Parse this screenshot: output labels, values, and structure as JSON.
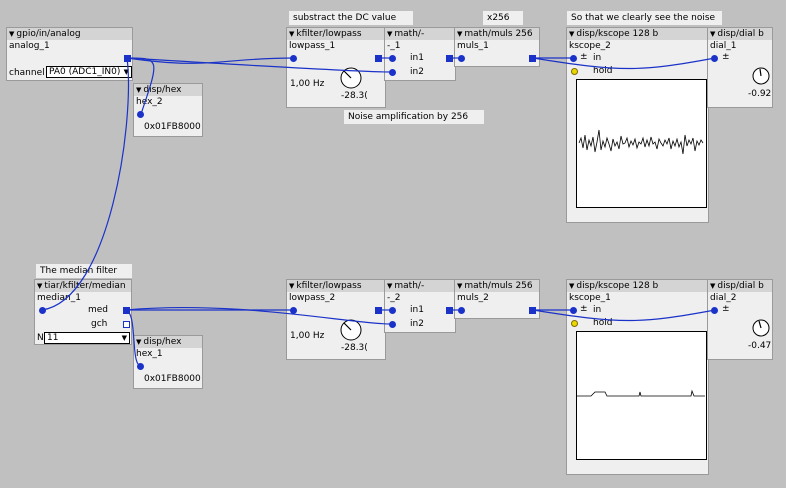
{
  "comments": {
    "dc": "substract the DC value",
    "x256": "x256",
    "noise": "So that we clearly see the noise",
    "amp": "Noise amplification by 256",
    "median": "The median filter"
  },
  "analog": {
    "type": "gpio/in/analog",
    "name": "analog_1",
    "channel_label": "channel",
    "channel_value": "PA0 (ADC1_IN0)"
  },
  "hex2": {
    "type": "disp/hex",
    "name": "hex_2",
    "value": "0x01FB8000"
  },
  "lowpass1": {
    "type": "kfilter/lowpass",
    "name": "lowpass_1",
    "freq": "1,00 Hz",
    "knob_value": "-28.3("
  },
  "minus1": {
    "type": "math/-",
    "name": "-_1",
    "in1": "in1",
    "in2": "in2"
  },
  "muls1": {
    "type": "math/muls 256",
    "name": "muls_1"
  },
  "kscope2": {
    "type": "disp/kscope 128 b",
    "name": "kscope_2",
    "pm": "±",
    "in": "in",
    "hold": "hold"
  },
  "dial1": {
    "type": "disp/dial b",
    "name": "dial_1",
    "pm": "±",
    "value": "-0.92"
  },
  "median": {
    "type": "tiar/kfilter/median",
    "name": "median_1",
    "med": "med",
    "gch": "gch",
    "n_label": "N",
    "n_value": "11"
  },
  "hex1": {
    "type": "disp/hex",
    "name": "hex_1",
    "value": "0x01FB8000"
  },
  "lowpass2": {
    "type": "kfilter/lowpass",
    "name": "lowpass_2",
    "freq": "1,00 Hz",
    "knob_value": "-28.3("
  },
  "minus2": {
    "type": "math/-",
    "name": "-_2",
    "in1": "in1",
    "in2": "in2"
  },
  "muls2": {
    "type": "math/muls 256",
    "name": "muls_2"
  },
  "kscope1": {
    "type": "disp/kscope 128 b",
    "name": "kscope_1",
    "pm": "±",
    "in": "in",
    "hold": "hold"
  },
  "dial2": {
    "type": "disp/dial b",
    "name": "dial_2",
    "pm": "±",
    "value": "-0.47"
  },
  "colors": {
    "wire": "#1a32c8",
    "header": "#d4d4d4",
    "body": "#efefef",
    "canvas": "#c0c0c0",
    "led": "#e8d800"
  },
  "icons": {
    "collapse": "triangle-down-icon",
    "knob": "knob-icon",
    "dial": "dial-icon"
  }
}
